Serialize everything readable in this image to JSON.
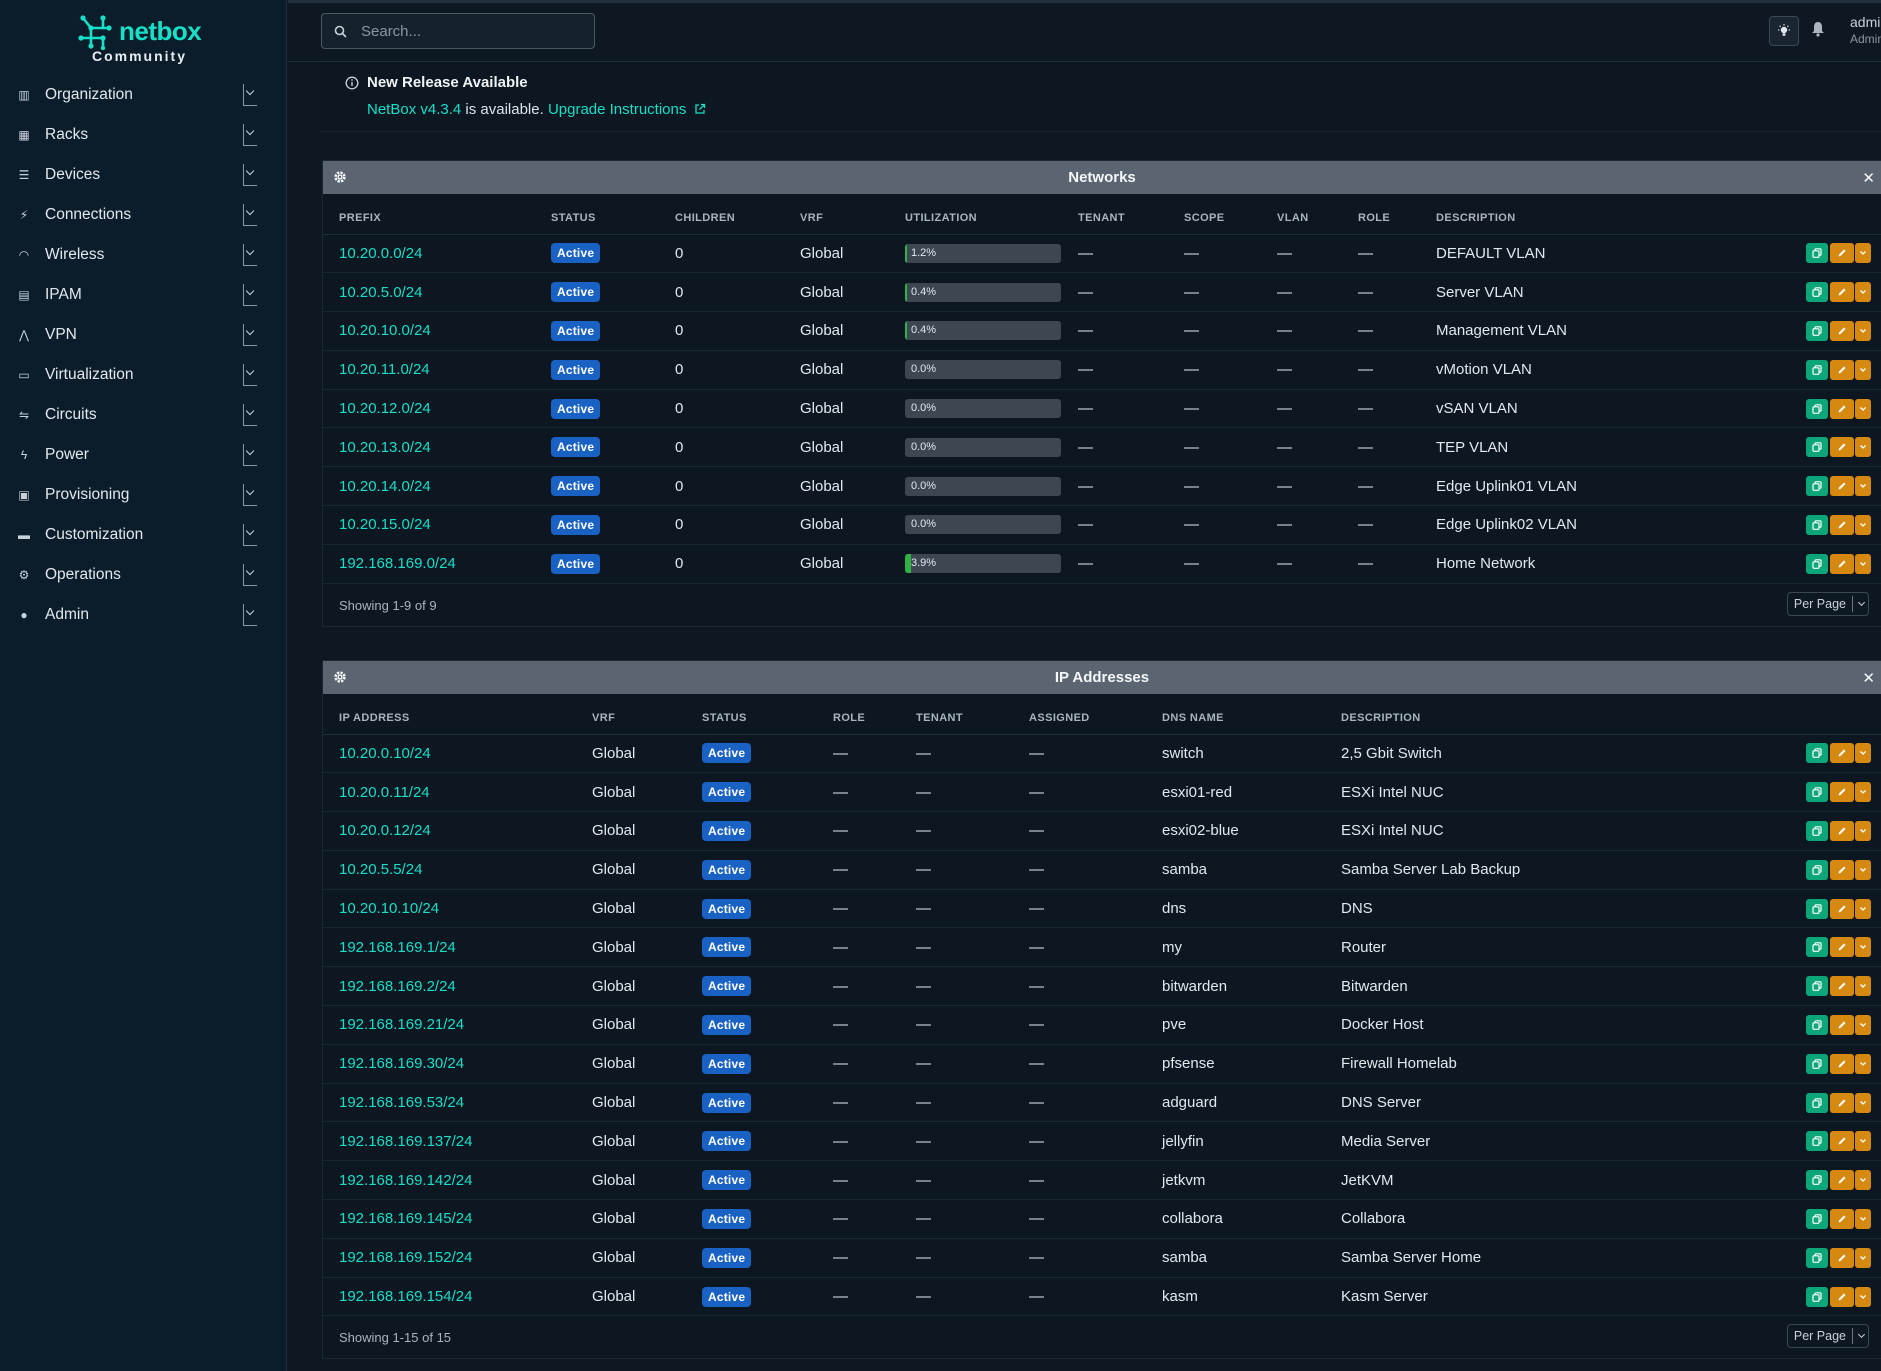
{
  "brand": {
    "name": "netbox",
    "edition": "Community"
  },
  "sidebar": {
    "items": [
      {
        "label": "Organization",
        "icon": "organization-icon"
      },
      {
        "label": "Racks",
        "icon": "rack-icon"
      },
      {
        "label": "Devices",
        "icon": "server-icon"
      },
      {
        "label": "Connections",
        "icon": "plug-icon"
      },
      {
        "label": "Wireless",
        "icon": "wifi-icon"
      },
      {
        "label": "IPAM",
        "icon": "counter-icon"
      },
      {
        "label": "VPN",
        "icon": "tunnel-icon"
      },
      {
        "label": "Virtualization",
        "icon": "monitor-icon"
      },
      {
        "label": "Circuits",
        "icon": "transit-icon"
      },
      {
        "label": "Power",
        "icon": "flash-icon"
      },
      {
        "label": "Provisioning",
        "icon": "file-icon"
      },
      {
        "label": "Customization",
        "icon": "toolbox-icon"
      },
      {
        "label": "Operations",
        "icon": "cogs-icon"
      },
      {
        "label": "Admin",
        "icon": "users-icon"
      }
    ]
  },
  "topbar": {
    "search_placeholder": "Search...",
    "user_name": "admi",
    "user_role": "Admin"
  },
  "banner": {
    "title": "New Release Available",
    "version_link": "NetBox v4.3.4",
    "available_text": " is available. ",
    "upgrade_link": "Upgrade Instructions"
  },
  "networks": {
    "title": "Networks",
    "columns": [
      "PREFIX",
      "STATUS",
      "CHILDREN",
      "VRF",
      "UTILIZATION",
      "TENANT",
      "SCOPE",
      "VLAN",
      "ROLE",
      "DESCRIPTION"
    ],
    "rows": [
      {
        "prefix": "10.20.0.0/24",
        "status": "Active",
        "children": "0",
        "vrf": "Global",
        "util_label": "1.2%",
        "util": 1.2,
        "tenant": "—",
        "scope": "—",
        "vlan": "—",
        "role": "—",
        "description": "DEFAULT VLAN"
      },
      {
        "prefix": "10.20.5.0/24",
        "status": "Active",
        "children": "0",
        "vrf": "Global",
        "util_label": "0.4%",
        "util": 0.4,
        "tenant": "—",
        "scope": "—",
        "vlan": "—",
        "role": "—",
        "description": "Server VLAN"
      },
      {
        "prefix": "10.20.10.0/24",
        "status": "Active",
        "children": "0",
        "vrf": "Global",
        "util_label": "0.4%",
        "util": 0.4,
        "tenant": "—",
        "scope": "—",
        "vlan": "—",
        "role": "—",
        "description": "Management VLAN"
      },
      {
        "prefix": "10.20.11.0/24",
        "status": "Active",
        "children": "0",
        "vrf": "Global",
        "util_label": "0.0%",
        "util": 0.0,
        "tenant": "—",
        "scope": "—",
        "vlan": "—",
        "role": "—",
        "description": "vMotion VLAN"
      },
      {
        "prefix": "10.20.12.0/24",
        "status": "Active",
        "children": "0",
        "vrf": "Global",
        "util_label": "0.0%",
        "util": 0.0,
        "tenant": "—",
        "scope": "—",
        "vlan": "—",
        "role": "—",
        "description": "vSAN VLAN"
      },
      {
        "prefix": "10.20.13.0/24",
        "status": "Active",
        "children": "0",
        "vrf": "Global",
        "util_label": "0.0%",
        "util": 0.0,
        "tenant": "—",
        "scope": "—",
        "vlan": "—",
        "role": "—",
        "description": "TEP VLAN"
      },
      {
        "prefix": "10.20.14.0/24",
        "status": "Active",
        "children": "0",
        "vrf": "Global",
        "util_label": "0.0%",
        "util": 0.0,
        "tenant": "—",
        "scope": "—",
        "vlan": "—",
        "role": "—",
        "description": "Edge Uplink01 VLAN"
      },
      {
        "prefix": "10.20.15.0/24",
        "status": "Active",
        "children": "0",
        "vrf": "Global",
        "util_label": "0.0%",
        "util": 0.0,
        "tenant": "—",
        "scope": "—",
        "vlan": "—",
        "role": "—",
        "description": "Edge Uplink02 VLAN"
      },
      {
        "prefix": "192.168.169.0/24",
        "status": "Active",
        "children": "0",
        "vrf": "Global",
        "util_label": "3.9%",
        "util": 3.9,
        "tenant": "—",
        "scope": "—",
        "vlan": "—",
        "role": "—",
        "description": "Home Network"
      }
    ],
    "showing": "Showing 1-9 of 9",
    "per_page": "Per Page"
  },
  "ip_addresses": {
    "title": "IP Addresses",
    "columns": [
      "IP ADDRESS",
      "VRF",
      "STATUS",
      "ROLE",
      "TENANT",
      "ASSIGNED",
      "DNS NAME",
      "DESCRIPTION"
    ],
    "rows": [
      {
        "address": "10.20.0.10/24",
        "vrf": "Global",
        "status": "Active",
        "role": "—",
        "tenant": "—",
        "assigned": "—",
        "dns": "switch",
        "description": "2,5 Gbit Switch"
      },
      {
        "address": "10.20.0.11/24",
        "vrf": "Global",
        "status": "Active",
        "role": "—",
        "tenant": "—",
        "assigned": "—",
        "dns": "esxi01-red",
        "description": "ESXi Intel NUC"
      },
      {
        "address": "10.20.0.12/24",
        "vrf": "Global",
        "status": "Active",
        "role": "—",
        "tenant": "—",
        "assigned": "—",
        "dns": "esxi02-blue",
        "description": "ESXi Intel NUC"
      },
      {
        "address": "10.20.5.5/24",
        "vrf": "Global",
        "status": "Active",
        "role": "—",
        "tenant": "—",
        "assigned": "—",
        "dns": "samba",
        "description": "Samba Server Lab Backup"
      },
      {
        "address": "10.20.10.10/24",
        "vrf": "Global",
        "status": "Active",
        "role": "—",
        "tenant": "—",
        "assigned": "—",
        "dns": "dns",
        "description": "DNS"
      },
      {
        "address": "192.168.169.1/24",
        "vrf": "Global",
        "status": "Active",
        "role": "—",
        "tenant": "—",
        "assigned": "—",
        "dns": "my",
        "description": "Router"
      },
      {
        "address": "192.168.169.2/24",
        "vrf": "Global",
        "status": "Active",
        "role": "—",
        "tenant": "—",
        "assigned": "—",
        "dns": "bitwarden",
        "description": "Bitwarden"
      },
      {
        "address": "192.168.169.21/24",
        "vrf": "Global",
        "status": "Active",
        "role": "—",
        "tenant": "—",
        "assigned": "—",
        "dns": "pve",
        "description": "Docker Host"
      },
      {
        "address": "192.168.169.30/24",
        "vrf": "Global",
        "status": "Active",
        "role": "—",
        "tenant": "—",
        "assigned": "—",
        "dns": "pfsense",
        "description": "Firewall Homelab"
      },
      {
        "address": "192.168.169.53/24",
        "vrf": "Global",
        "status": "Active",
        "role": "—",
        "tenant": "—",
        "assigned": "—",
        "dns": "adguard",
        "description": "DNS Server"
      },
      {
        "address": "192.168.169.137/24",
        "vrf": "Global",
        "status": "Active",
        "role": "—",
        "tenant": "—",
        "assigned": "—",
        "dns": "jellyfin",
        "description": "Media Server"
      },
      {
        "address": "192.168.169.142/24",
        "vrf": "Global",
        "status": "Active",
        "role": "—",
        "tenant": "—",
        "assigned": "—",
        "dns": "jetkvm",
        "description": "JetKVM"
      },
      {
        "address": "192.168.169.145/24",
        "vrf": "Global",
        "status": "Active",
        "role": "—",
        "tenant": "—",
        "assigned": "—",
        "dns": "collabora",
        "description": "Collabora"
      },
      {
        "address": "192.168.169.152/24",
        "vrf": "Global",
        "status": "Active",
        "role": "—",
        "tenant": "—",
        "assigned": "—",
        "dns": "samba",
        "description": "Samba Server Home"
      },
      {
        "address": "192.168.169.154/24",
        "vrf": "Global",
        "status": "Active",
        "role": "—",
        "tenant": "—",
        "assigned": "—",
        "dns": "kasm",
        "description": "Kasm Server"
      }
    ],
    "showing": "Showing 1-15 of 15",
    "per_page": "Per Page"
  },
  "colors": {
    "accent": "#17dfc8",
    "status_active": "#1a61c4",
    "utilization": "#2fb344",
    "copy_button": "#0ca678",
    "edit_button": "#d68910"
  }
}
